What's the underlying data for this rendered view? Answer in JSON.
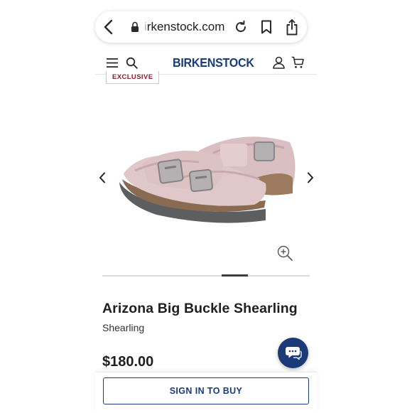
{
  "browser": {
    "url_faded": "i",
    "url_main": "rkenstock.com"
  },
  "header": {
    "logo": "BIRKENSTOCK"
  },
  "product": {
    "badge": "EXCLUSIVE",
    "title": "Arizona Big Buckle Shearling",
    "material": "Shearling",
    "price": "$180.00",
    "carousel_position": 0.66
  },
  "cta": {
    "sign_in_label": "SIGN IN TO BUY"
  },
  "icons": {
    "back": "chevron-left-icon",
    "lock": "lock-icon",
    "reload": "reload-icon",
    "bookmark": "bookmark-icon",
    "share": "share-icon",
    "menu": "hamburger-menu-icon",
    "search": "search-icon",
    "account": "user-icon",
    "cart": "cart-icon",
    "zoom": "zoom-in-icon",
    "chat": "chat-icon"
  },
  "colors": {
    "brand_blue": "#1a3d79",
    "badge_red": "#8c1d2b"
  }
}
